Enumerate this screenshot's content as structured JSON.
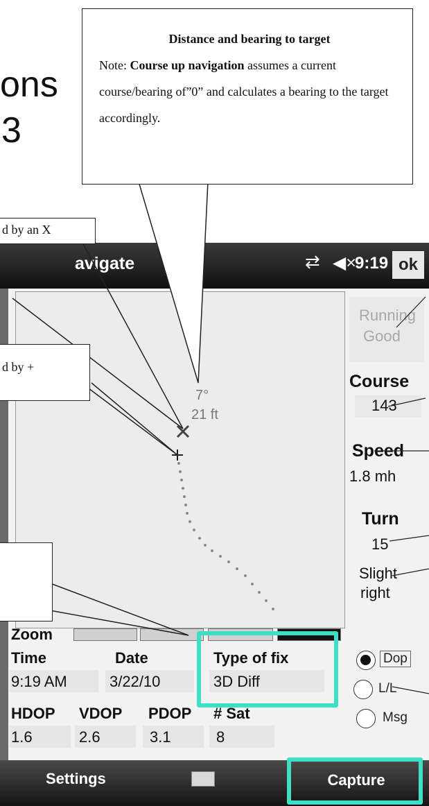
{
  "background_text": {
    "line1": "ons",
    "line2": "3"
  },
  "callouts": {
    "main": {
      "title": "Distance and bearing to target",
      "note_prefix": "Note: ",
      "note_bold": "Course up navigation",
      "note_rest": " assumes a current course/bearing of”0” and calculates a bearing to the target accordingly."
    },
    "x_marker": "d by an X",
    "plus_marker": "d by +"
  },
  "titlebar": {
    "title": "avigate",
    "time": "9:19",
    "ok_label": "ok",
    "sync_icon": "sync-arrows-icon",
    "volume_icon": "speaker-muted-icon"
  },
  "map": {
    "bearing_label": "7°",
    "distance_label": "21 ft"
  },
  "right_panel": {
    "status_line1": "Running",
    "status_line2": "Good",
    "course_label": "Course",
    "course_value": "143",
    "speed_label": "Speed",
    "speed_value": "1.8 mh",
    "turn_label": "Turn",
    "turn_value": "15",
    "turn_dir1": "Slight",
    "turn_dir2": "right"
  },
  "zoom_label": "Zoom",
  "info": {
    "time_label": "Time",
    "time_value": "9:19 AM",
    "date_label": "Date",
    "date_value": "3/22/10",
    "fix_label": "Type of fix",
    "fix_value": "3D Diff",
    "hdop_label": "HDOP",
    "hdop_value": "1.6",
    "vdop_label": "VDOP",
    "vdop_value": "2.6",
    "pdop_label": "PDOP",
    "pdop_value": "3.1",
    "sat_label": "# Sat",
    "sat_value": "8"
  },
  "radios": {
    "dop": "Dop",
    "ll": "L/L",
    "msg": "Msg",
    "selected": "Dop"
  },
  "bottom": {
    "settings": "Settings",
    "capture": "Capture",
    "keyboard_icon": "keyboard-icon"
  },
  "highlight_color": "#3de0c4"
}
